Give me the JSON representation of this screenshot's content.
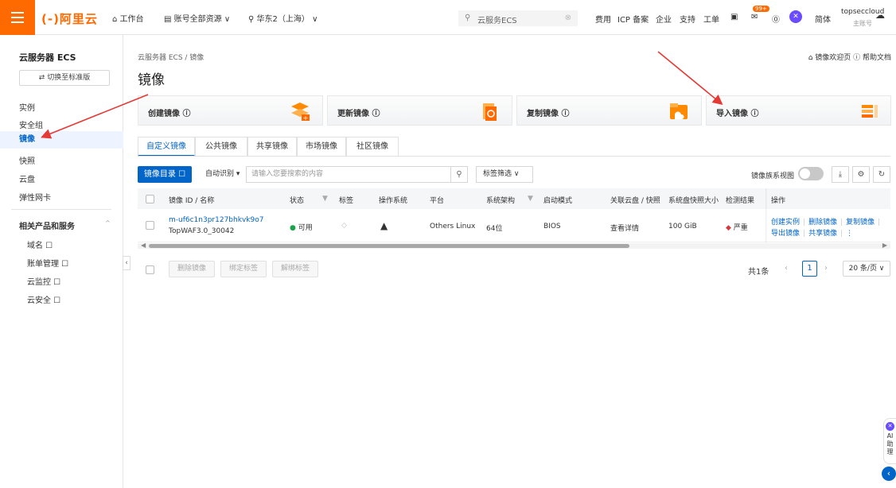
{
  "topbar": {
    "logo": "(-)阿里云",
    "workbench": "工作台",
    "resources": "账号全部资源",
    "region": "华东2（上海）",
    "search_placeholder": "云服务ECS",
    "nav": [
      "费用",
      "ICP 备案",
      "企业",
      "支持",
      "工单"
    ],
    "badge": "99+",
    "lang": "简体",
    "user": "topseccloud",
    "user_sub": "主账号"
  },
  "sidebar": {
    "title": "云服务器 ECS",
    "switch": "⇄ 切换至标准版",
    "items": [
      "实例",
      "安全组",
      "镜像",
      "快照",
      "云盘",
      "弹性网卡"
    ],
    "section": "相关产品和服务",
    "sub_items": [
      "域名 ☐",
      "账单管理 ☐",
      "云监控 ☐",
      "云安全 ☐"
    ]
  },
  "main": {
    "breadcrumb": "云服务器 ECS / 镜像",
    "title": "镜像",
    "links": "⌂ 镜像欢迎页 ⓘ 帮助文档",
    "cards": [
      "创建镜像 ⓘ",
      "更新镜像 ⓘ",
      "复制镜像 ⓘ",
      "导入镜像 ⓘ"
    ],
    "tabs": [
      "自定义镜像",
      "公共镜像",
      "共享镜像",
      "市场镜像",
      "社区镜像"
    ],
    "toolbar": {
      "catalog": "镜像目录 ☐",
      "filter_select": "自动识别 ▾",
      "search_placeholder": "请输入您要搜索的内容",
      "tag_filter": "标签筛选 ∨",
      "family_view": "镜像族系视图"
    },
    "table": {
      "headers": [
        "镜像 ID / 名称",
        "状态",
        "标签",
        "操作系统",
        "平台",
        "系统架构",
        "启动模式",
        "关联云盘 / 快照",
        "系统盘快照大小",
        "检测结果",
        "操作"
      ],
      "rows": [
        {
          "id": "m-uf6c1n3pr127bhkvk9o7",
          "name": "TopWAF3.0_30042",
          "status": "可用",
          "platform": "Others Linux",
          "arch": "64位",
          "boot": "BIOS",
          "disk": "查看详情",
          "size": "100 GiB",
          "check": "严重",
          "ops1": [
            "创建实例",
            "删除镜像",
            "复制镜像"
          ],
          "ops2": [
            "导出镜像",
            "共享镜像"
          ]
        }
      ]
    },
    "bulk_actions": [
      "删除镜像",
      "绑定标签",
      "解绑标签"
    ],
    "pagination": {
      "total": "共1条",
      "current": "1",
      "page_size": "20 条/页 ∨"
    }
  },
  "assistant": {
    "label": "AI助理"
  }
}
